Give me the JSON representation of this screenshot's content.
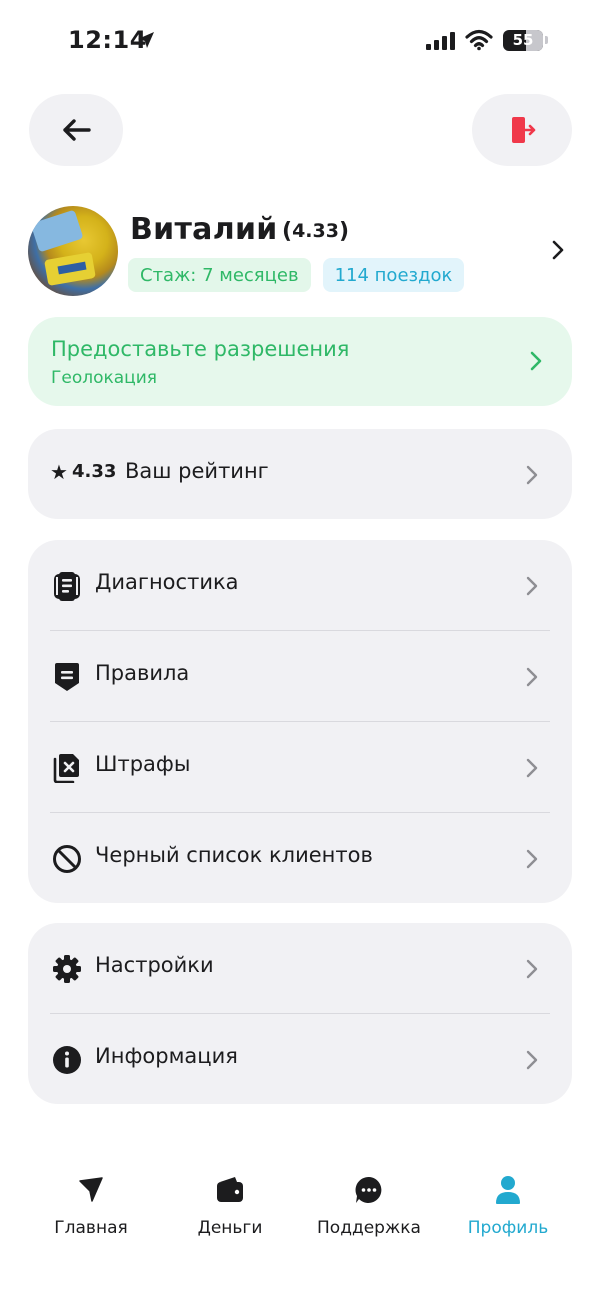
{
  "status_bar": {
    "time": "12:14",
    "battery": "55"
  },
  "profile": {
    "name": "Виталий",
    "rating": "4.33",
    "experience_badge": "Стаж: 7 месяцев",
    "trips_badge": "114 поездок"
  },
  "permission_banner": {
    "title": "Предоставьте разрешения",
    "subtitle": "Геолокация"
  },
  "rating_card": {
    "star": "★",
    "value": "4.33",
    "label": "Ваш рейтинг"
  },
  "menu_main": [
    {
      "label": "Диагностика",
      "icon": "document-icon"
    },
    {
      "label": "Правила",
      "icon": "rules-icon"
    },
    {
      "label": "Штрафы",
      "icon": "fines-icon"
    },
    {
      "label": "Черный список клиентов",
      "icon": "block-icon"
    }
  ],
  "menu_secondary": [
    {
      "label": "Настройки",
      "icon": "gear-icon"
    },
    {
      "label": "Информация",
      "icon": "info-icon"
    }
  ],
  "tabbar": [
    {
      "label": "Главная",
      "icon": "navigation-icon",
      "active": false
    },
    {
      "label": "Деньги",
      "icon": "wallet-icon",
      "active": false
    },
    {
      "label": "Поддержка",
      "icon": "chat-icon",
      "active": false
    },
    {
      "label": "Профиль",
      "icon": "person-icon",
      "active": true
    }
  ],
  "colors": {
    "accent": "#22a9cf",
    "success": "#2fb867",
    "danger": "#f0384a",
    "card_bg": "#f1f1f4",
    "success_bg": "#e6f8ec"
  }
}
